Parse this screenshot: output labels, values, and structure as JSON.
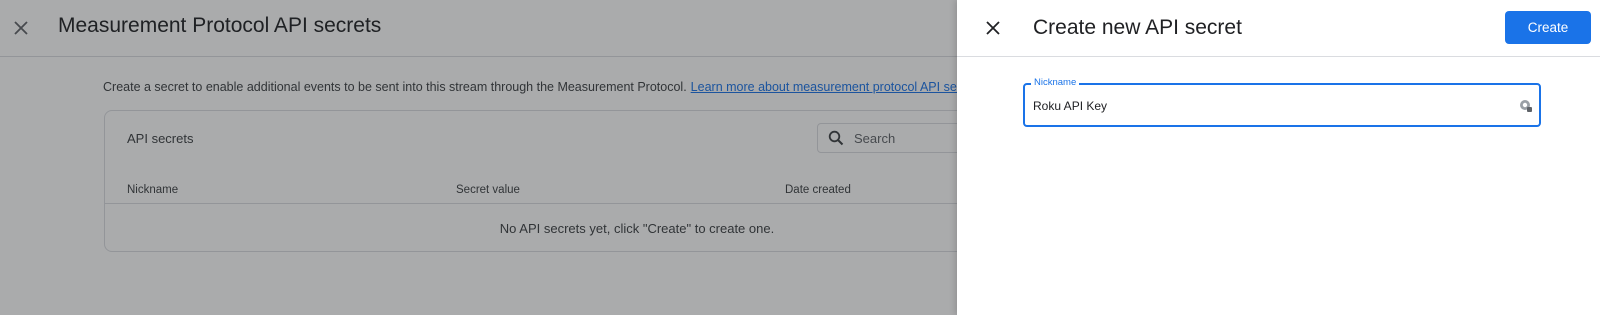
{
  "page": {
    "title": "Measurement Protocol API secrets",
    "intro": "Create a secret to enable additional events to be sent into this stream through the Measurement Protocol.",
    "intro_link": "Learn more about measurement protocol API secrets",
    "card": {
      "title": "API secrets",
      "search_placeholder": "Search",
      "columns": [
        "Nickname",
        "Secret value",
        "Date created"
      ],
      "empty_message": "No API secrets yet, click \"Create\" to create one."
    }
  },
  "panel": {
    "title": "Create new API secret",
    "create_label": "Create",
    "nickname_label": "Nickname",
    "nickname_value": "Roku API Key"
  },
  "icons": {
    "page_close": "close-icon",
    "panel_close": "close-icon",
    "search": "search-icon",
    "field_trailing": "password-manager-icon"
  },
  "colors": {
    "accent": "#1a73e8",
    "scrim": "#202124",
    "text": "#202124"
  }
}
